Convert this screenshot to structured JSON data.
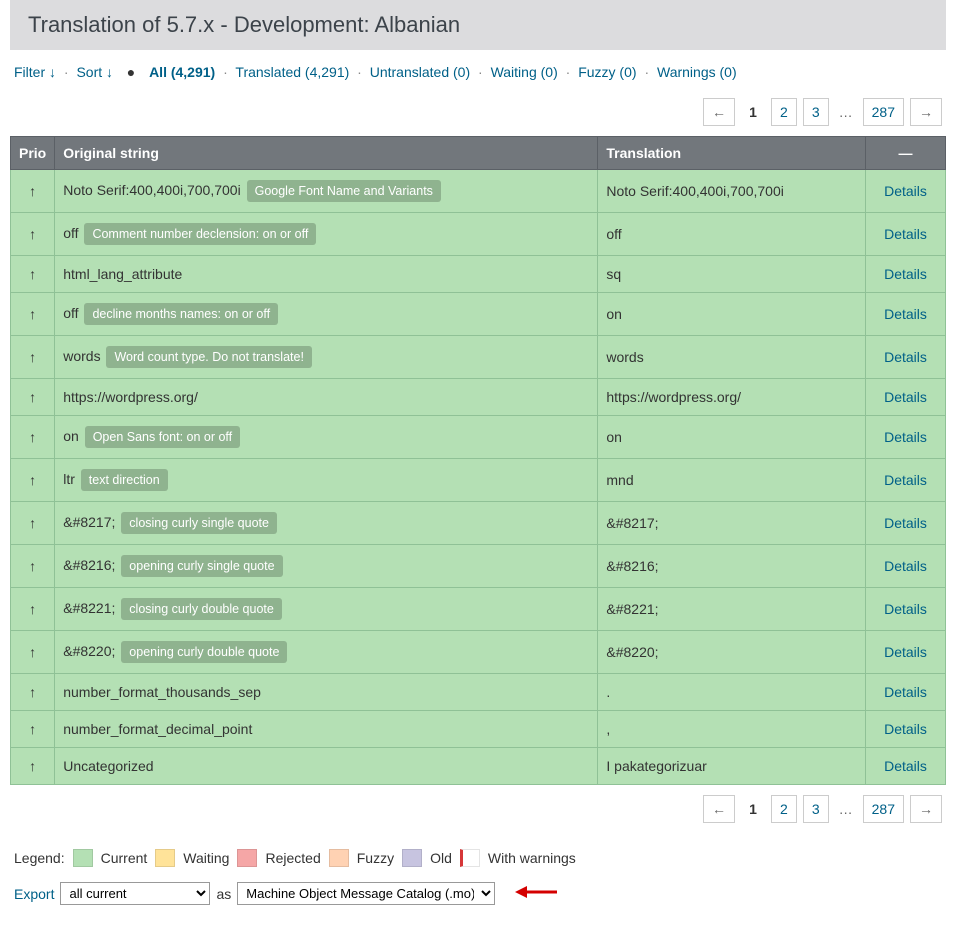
{
  "header": {
    "title": "Translation of 5.7.x - Development: Albanian"
  },
  "filter": {
    "filter_label": "Filter ↓",
    "sort_label": "Sort ↓",
    "all": "All (4,291)",
    "translated": "Translated (4,291)",
    "untranslated": "Untranslated (0)",
    "waiting": "Waiting (0)",
    "fuzzy": "Fuzzy (0)",
    "warnings": "Warnings (0)"
  },
  "pagination": {
    "prev": "←",
    "current": "1",
    "p2": "2",
    "p3": "3",
    "dots": "…",
    "last": "287",
    "next": "→"
  },
  "table": {
    "head": {
      "prio": "Prio",
      "original": "Original string",
      "translation": "Translation",
      "det": "—"
    },
    "details_label": "Details",
    "rows": [
      {
        "prio": "↑",
        "orig": "Noto Serif:400,400i,700,700i",
        "ctx": "Google Font Name and Variants",
        "trans": "Noto Serif:400,400i,700,700i"
      },
      {
        "prio": "↑",
        "orig": "off",
        "ctx": "Comment number declension: on or off",
        "trans": "off"
      },
      {
        "prio": "↑",
        "orig": "html_lang_attribute",
        "ctx": "",
        "trans": "sq"
      },
      {
        "prio": "↑",
        "orig": "off",
        "ctx": "decline months names: on or off",
        "trans": "on"
      },
      {
        "prio": "↑",
        "orig": "words",
        "ctx": "Word count type. Do not translate!",
        "trans": "words"
      },
      {
        "prio": "↑",
        "orig": "https://wordpress.org/",
        "ctx": "",
        "trans": "https://wordpress.org/"
      },
      {
        "prio": "↑",
        "orig": "on",
        "ctx": "Open Sans font: on or off",
        "trans": "on"
      },
      {
        "prio": "↑",
        "orig": "ltr",
        "ctx": "text direction",
        "trans": "mnd"
      },
      {
        "prio": "↑",
        "orig": "&#8217;",
        "ctx": "closing curly single quote",
        "trans": "&#8217;"
      },
      {
        "prio": "↑",
        "orig": "&#8216;",
        "ctx": "opening curly single quote",
        "trans": "&#8216;"
      },
      {
        "prio": "↑",
        "orig": "&#8221;",
        "ctx": "closing curly double quote",
        "trans": "&#8221;"
      },
      {
        "prio": "↑",
        "orig": "&#8220;",
        "ctx": "opening curly double quote",
        "trans": "&#8220;"
      },
      {
        "prio": "↑",
        "orig": "number_format_thousands_sep",
        "ctx": "",
        "trans": "."
      },
      {
        "prio": "↑",
        "orig": "number_format_decimal_point",
        "ctx": "",
        "trans": ","
      },
      {
        "prio": "↑",
        "orig": "Uncategorized",
        "ctx": "",
        "trans": "I pakategorizuar"
      }
    ]
  },
  "legend": {
    "label": "Legend:",
    "current": "Current",
    "waiting": "Waiting",
    "rejected": "Rejected",
    "fuzzy": "Fuzzy",
    "old": "Old",
    "with_warnings": "With warnings"
  },
  "export": {
    "export_label": "Export",
    "scope": "all current",
    "as": "as",
    "format": "Machine Object Message Catalog (.mo)"
  }
}
